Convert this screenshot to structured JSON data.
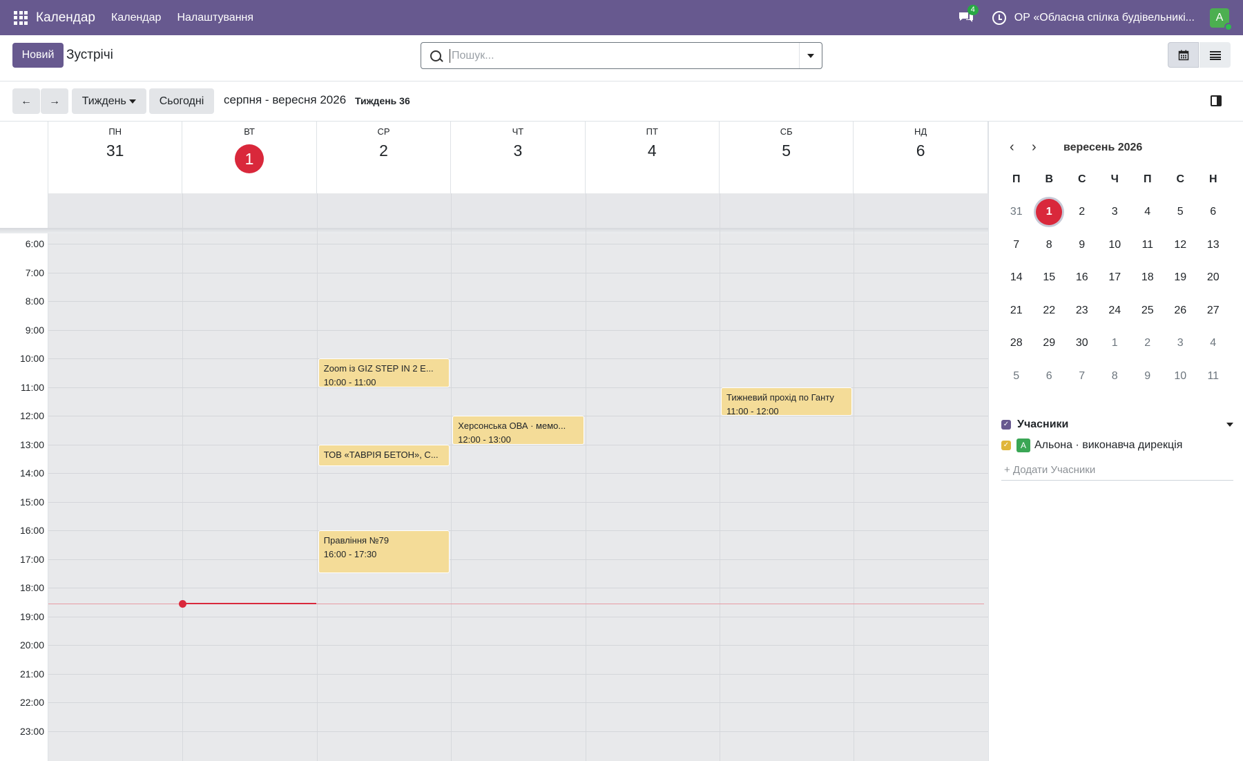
{
  "topbar": {
    "app_name": "Календар",
    "menu": [
      "Календар",
      "Налаштування"
    ],
    "chat_count": "4",
    "company": "ОР «Обласна спілка будівельникі...",
    "avatar_letter": "A",
    "bg_color": "#67598f"
  },
  "control": {
    "new_label": "Новий",
    "breadcrumb": "Зустрічі",
    "search_placeholder": "Пошук..."
  },
  "nav": {
    "scale_label": "Тиждень",
    "today_label": "Сьогодні",
    "range": "серпня - вересня 2026",
    "week": "Тиждень 36"
  },
  "days": [
    {
      "name": "ПН",
      "num": "31"
    },
    {
      "name": "ВТ",
      "num": "1",
      "today": true
    },
    {
      "name": "СР",
      "num": "2"
    },
    {
      "name": "ЧТ",
      "num": "3"
    },
    {
      "name": "ПТ",
      "num": "4"
    },
    {
      "name": "СБ",
      "num": "5"
    },
    {
      "name": "НД",
      "num": "6"
    }
  ],
  "hours": [
    "6:00",
    "7:00",
    "8:00",
    "9:00",
    "10:00",
    "11:00",
    "12:00",
    "13:00",
    "14:00",
    "15:00",
    "16:00",
    "17:00",
    "18:00",
    "19:00",
    "20:00",
    "21:00",
    "22:00",
    "23:00"
  ],
  "events": [
    {
      "title": "Zoom із GIZ STEP IN 2 E...",
      "time": "10:00 - 11:00",
      "day": 2,
      "start": 10,
      "end": 11
    },
    {
      "title": "ТОВ «ТАВРІЯ БЕТОН», С...",
      "time": "13:00 - 13:45",
      "day": 2,
      "start": 13,
      "end": 13.75
    },
    {
      "title": "Правління №79",
      "time": "16:00 - 17:30",
      "day": 2,
      "start": 16,
      "end": 17.5
    },
    {
      "title": "Херсонська ОВА · мемо...",
      "time": "12:00 - 13:00",
      "day": 3,
      "start": 12,
      "end": 13
    },
    {
      "title": "Тижневий прохід по Ганту",
      "time": "11:00 - 12:00",
      "day": 5,
      "start": 11,
      "end": 12
    }
  ],
  "event_color": "#f4dc98",
  "today_color": "#d9283b",
  "minical": {
    "title": "вересень 2026",
    "weekdays": [
      "П",
      "В",
      "С",
      "Ч",
      "П",
      "С",
      "Н"
    ],
    "weeks": [
      [
        "31",
        "1",
        "2",
        "3",
        "4",
        "5",
        "6"
      ],
      [
        "7",
        "8",
        "9",
        "10",
        "11",
        "12",
        "13"
      ],
      [
        "14",
        "15",
        "16",
        "17",
        "18",
        "19",
        "20"
      ],
      [
        "21",
        "22",
        "23",
        "24",
        "25",
        "26",
        "27"
      ],
      [
        "28",
        "29",
        "30",
        "1",
        "2",
        "3",
        "4"
      ],
      [
        "5",
        "6",
        "7",
        "8",
        "9",
        "10",
        "11"
      ]
    ]
  },
  "filters": {
    "heading": "Учасники",
    "items": [
      {
        "avatar": "A",
        "label": "Альона · виконавча дирекція"
      }
    ],
    "add_label": "+ Додати Учасники"
  }
}
